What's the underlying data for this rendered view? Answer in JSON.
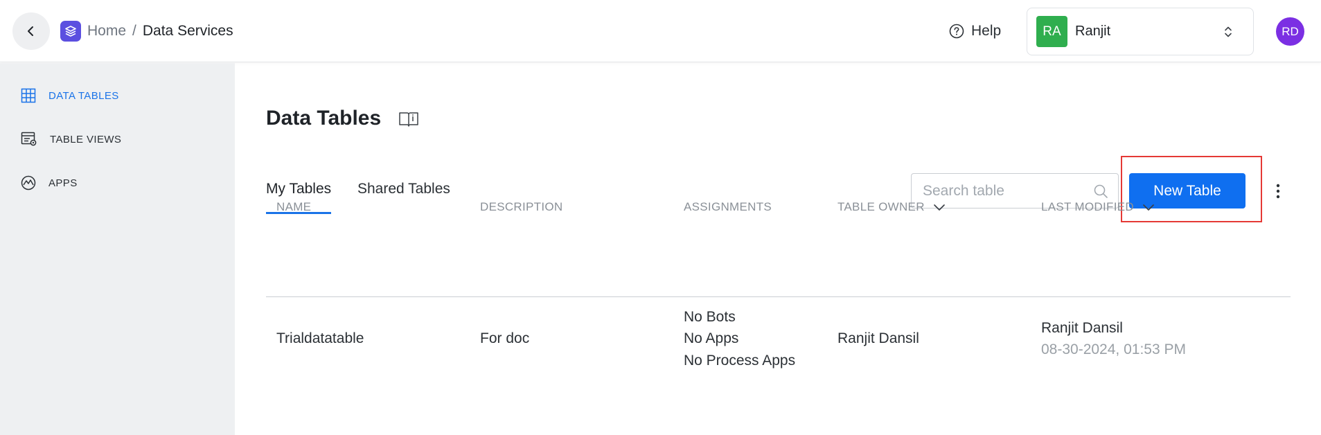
{
  "header": {
    "breadcrumb": {
      "home": "Home",
      "separator": "/",
      "current": "Data Services"
    },
    "help_label": "Help",
    "workspace": {
      "initials": "RA",
      "name": "Ranjit",
      "badge_color": "#2fae4e"
    },
    "user_initials": "RD",
    "icons": [
      "chevron-left-icon",
      "layers-icon",
      "help-circle-icon",
      "updown-chevron-icon"
    ]
  },
  "sidebar": {
    "items": [
      {
        "label": "DATA TABLES",
        "icon": "grid-icon",
        "active": true
      },
      {
        "label": "TABLE VIEWS",
        "icon": "table-view-icon",
        "active": false
      },
      {
        "label": "APPS",
        "icon": "apps-icon",
        "active": false
      }
    ]
  },
  "main": {
    "title": "Data Tables",
    "tabs": [
      {
        "label": "My Tables",
        "active": true
      },
      {
        "label": "Shared Tables",
        "active": false
      }
    ],
    "search_placeholder": "Search table",
    "new_table_label": "New Table",
    "table": {
      "columns": [
        "NAME",
        "DESCRIPTION",
        "ASSIGNMENTS",
        "TABLE OWNER",
        "LAST MODIFIED"
      ],
      "rows": [
        {
          "name": "Trialdatatable",
          "description": "For doc",
          "assignments": [
            "No Bots",
            "No Apps",
            "No Process Apps"
          ],
          "owner": "Ranjit Dansil",
          "modified_by": "Ranjit Dansil",
          "modified_at": "08-30-2024, 01:53 PM"
        }
      ]
    }
  },
  "colors": {
    "accent": "#1a73e8",
    "primary_button": "#0f6ff0",
    "logo": "#5b4fe0",
    "avatar": "#7b2fe3",
    "highlight": "#e53935"
  }
}
